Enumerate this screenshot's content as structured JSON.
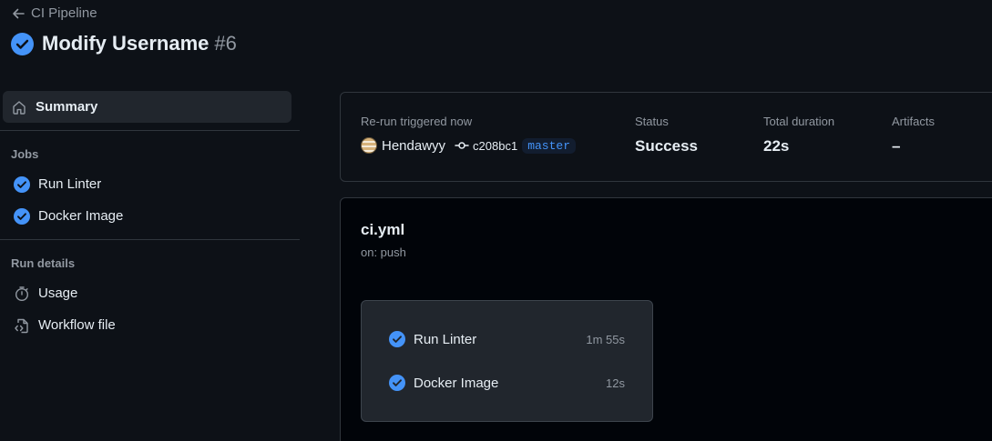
{
  "header": {
    "back_label": "CI Pipeline",
    "title": "Modify Username",
    "run_number": "#6"
  },
  "sidebar": {
    "summary_label": "Summary",
    "jobs_heading": "Jobs",
    "jobs": [
      {
        "label": "Run Linter",
        "icon": "check-circle-icon"
      },
      {
        "label": "Docker Image",
        "icon": "check-circle-icon"
      }
    ],
    "run_details_heading": "Run details",
    "details": [
      {
        "label": "Usage",
        "icon": "stopwatch-icon"
      },
      {
        "label": "Workflow file",
        "icon": "file-code-icon"
      }
    ]
  },
  "summary": {
    "trigger_label": "Re-run triggered now",
    "user": "Hendawyy",
    "commit": "c208bc1",
    "branch": "master",
    "status_label": "Status",
    "status_value": "Success",
    "duration_label": "Total duration",
    "duration_value": "22s",
    "artifacts_label": "Artifacts",
    "artifacts_value": "–"
  },
  "workflow": {
    "file": "ci.yml",
    "trigger": "on: push",
    "jobs": [
      {
        "name": "Run Linter",
        "time": "1m 55s"
      },
      {
        "name": "Docker Image",
        "time": "12s"
      }
    ]
  },
  "colors": {
    "background": "#0d1117",
    "success": "#4493f8",
    "text": "#e6edf3",
    "muted": "#9198a1",
    "border": "#30363d"
  }
}
